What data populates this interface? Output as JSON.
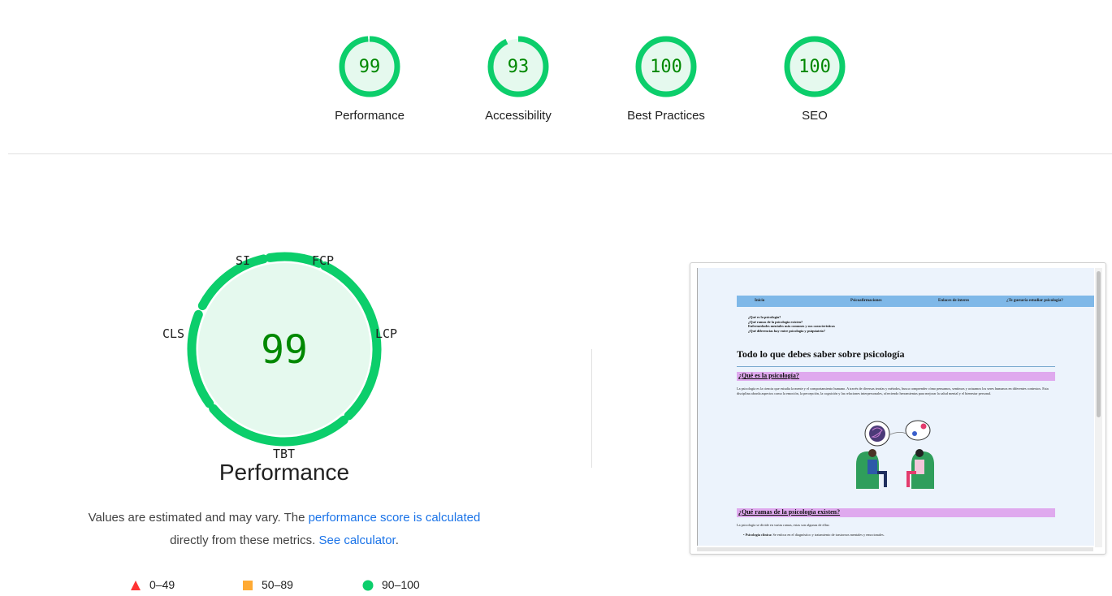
{
  "scores": [
    {
      "label": "Performance",
      "value": "99",
      "fraction": 0.99
    },
    {
      "label": "Accessibility",
      "value": "93",
      "fraction": 0.93
    },
    {
      "label": "Best Practices",
      "value": "100",
      "fraction": 1.0
    },
    {
      "label": "SEO",
      "value": "100",
      "fraction": 1.0
    }
  ],
  "performance": {
    "score": "99",
    "title": "Performance",
    "metrics": {
      "si": "SI",
      "fcp": "FCP",
      "lcp": "LCP",
      "tbt": "TBT",
      "cls": "CLS"
    },
    "note_text_1": "Values are estimated and may vary. The ",
    "note_link_1": "performance score is calculated",
    "note_text_2": " directly from these metrics. ",
    "note_link_2": "See calculator",
    "note_text_3": "."
  },
  "legend": [
    {
      "range": "0–49",
      "color": "#ff3333",
      "shape": "triangle"
    },
    {
      "range": "50–89",
      "color": "#ffaa33",
      "shape": "square"
    },
    {
      "range": "90–100",
      "color": "#0cce6b",
      "shape": "circle"
    }
  ],
  "colors": {
    "pass": "#0cce6b",
    "pass_fill": "#e5f9ee",
    "pass_text": "#008800",
    "link": "#1a73e8"
  },
  "thumbnail": {
    "nav": [
      "Inicio",
      "Psicoafirmaciones",
      "Enlaces de interes",
      "¿Te gustaría estudiar psicología?"
    ],
    "links": [
      "¿Qué es la psicología?",
      "¿Qué ramas de la psicología existen?",
      "Enfermedades mentales más comunes y sus características",
      "¿Qué diferencias hay entre psicología y psiquiatría?"
    ],
    "heading": "Todo lo que debes saber sobre psicología",
    "section1": "¿Qué es la psicología?",
    "para1": "La psicología es la ciencia que estudia la mente y el comportamiento humano. A través de diversas teorías y métodos, busca comprender cómo pensamos, sentimos y actuamos los seres humanos en diferentes contextos. Esta disciplina aborda aspectos como la emoción, la percepción, la cognición y las relaciones interpersonales, ofreciendo herramientas para mejorar la salud mental y el bienestar personal.",
    "section2": "¿Qué ramas de la psicología existen?",
    "para2": "La psicología se divide en varias ramas, estas son algunas de ellas:",
    "bullet1_bold": "Psicología clínica:",
    "bullet1_text": " Se enfoca en el diagnóstico y tratamiento de trastornos mentales y emocionales."
  }
}
